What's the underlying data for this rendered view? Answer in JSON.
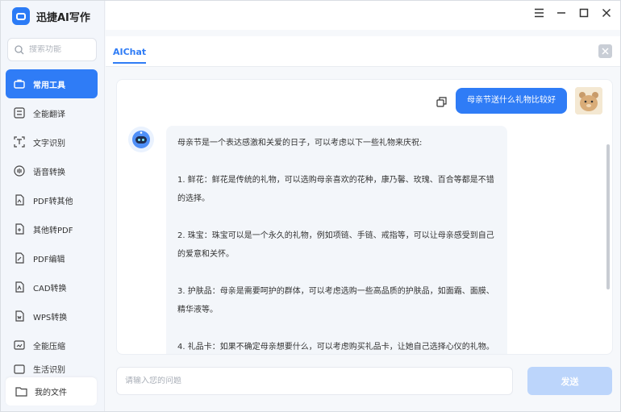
{
  "app": {
    "title": "迅捷AI写作"
  },
  "search": {
    "placeholder": "搜索功能"
  },
  "sidebar": {
    "items": [
      {
        "label": "常用工具",
        "icon": "toolbox-icon"
      },
      {
        "label": "全能翻译",
        "icon": "translate-icon"
      },
      {
        "label": "文字识别",
        "icon": "ocr-icon"
      },
      {
        "label": "语音转换",
        "icon": "voice-icon"
      },
      {
        "label": "PDF转其他",
        "icon": "pdf-export-icon"
      },
      {
        "label": "其他转PDF",
        "icon": "pdf-import-icon"
      },
      {
        "label": "PDF编辑",
        "icon": "pdf-edit-icon"
      },
      {
        "label": "CAD转换",
        "icon": "cad-icon"
      },
      {
        "label": "WPS转换",
        "icon": "wps-icon"
      },
      {
        "label": "全能压缩",
        "icon": "compress-icon"
      },
      {
        "label": "生活识别",
        "icon": "scan-icon"
      }
    ],
    "my_files": "我的文件"
  },
  "tabs": [
    {
      "label": "AIChat"
    }
  ],
  "chat": {
    "user_message": "母亲节送什么礼物比较好",
    "bot_paragraphs": [
      "母亲节是一个表达感激和关爱的日子，可以考虑以下一些礼物来庆祝:",
      "1. 鲜花：鲜花是传统的礼物，可以选购母亲喜欢的花种，康乃馨、玫瑰、百合等都是不错的选择。",
      "2. 珠宝：珠宝可以是一个永久的礼物，例如项链、手链、戒指等，可以让母亲感受到自己的爱意和关怀。",
      "3. 护肤品：母亲是需要呵护的群体，可以考虑选购一些高品质的护肤品，如面霜、面膜、精华液等。",
      "4. 礼品卡：如果不确定母亲想要什么，可以考虑购买礼品卡，让她自己选择心仪的礼物。"
    ]
  },
  "input": {
    "placeholder": "请输入您的问题"
  },
  "send_label": "发送",
  "colors": {
    "accent": "#2f7cf6",
    "send_disabled": "#bcd5fb"
  }
}
